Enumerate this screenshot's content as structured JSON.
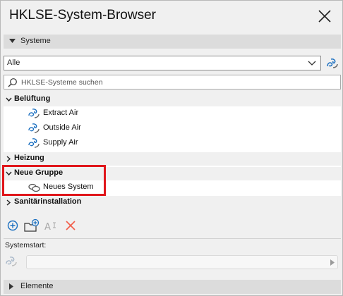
{
  "window": {
    "title": "HKLSE-System-Browser"
  },
  "systeme_section": {
    "label": "Systeme"
  },
  "filter": {
    "selected": "Alle"
  },
  "search": {
    "placeholder": "HKLSE-Systeme suchen"
  },
  "tree": {
    "groups": [
      {
        "label": "Belüftung",
        "expanded": true,
        "children": [
          "Extract Air",
          "Outside Air",
          "Supply Air"
        ]
      },
      {
        "label": "Heizung",
        "expanded": false,
        "children": []
      },
      {
        "label": "Neue Gruppe",
        "expanded": true,
        "children": [
          "Neues System"
        ]
      },
      {
        "label": "Sanitärinstallation",
        "expanded": false,
        "children": []
      }
    ]
  },
  "toolbar": {
    "icons": [
      "add-system-icon",
      "new-folder-icon",
      "rename-icon",
      "delete-icon"
    ]
  },
  "systemstart": {
    "label": "Systemstart:",
    "value": ""
  },
  "elemente_section": {
    "label": "Elemente"
  },
  "colors": {
    "highlight": "#e0161b",
    "accent": "#1a6fc0",
    "delete": "#f25e4a"
  }
}
